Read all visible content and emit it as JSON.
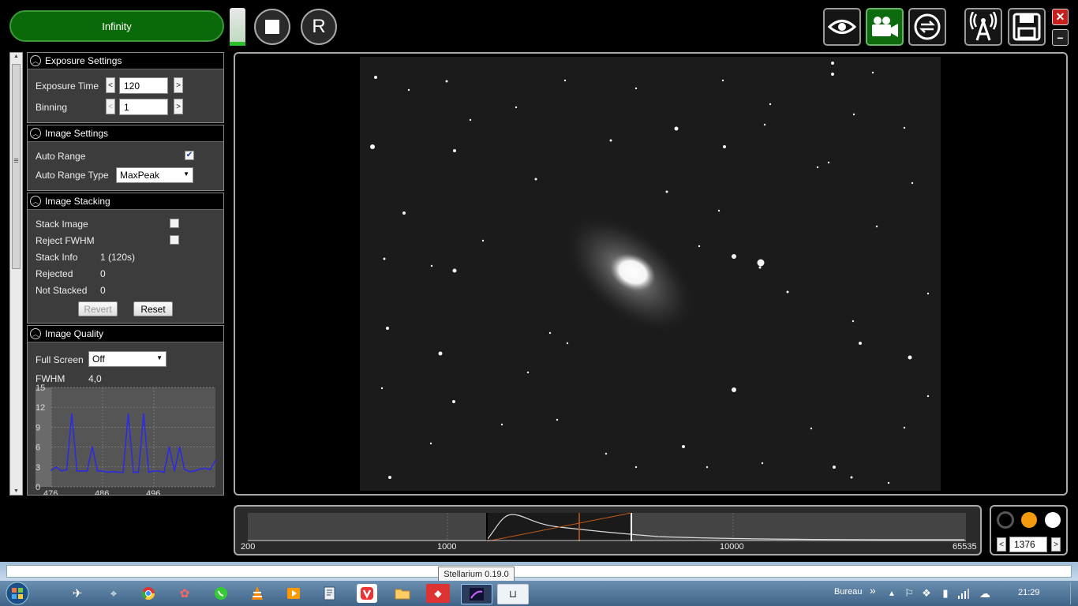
{
  "top_bar": {
    "mode_label": "Infinity",
    "stop_label": "■",
    "r_label": "R",
    "level_fraction": 0.1
  },
  "exposure": {
    "header": "Exposure Settings",
    "exposure_time_label": "Exposure Time",
    "exposure_time_value": "120",
    "binning_label": "Binning",
    "binning_value": "1",
    "dec": "<",
    "inc": ">"
  },
  "image_settings": {
    "header": "Image Settings",
    "auto_range_label": "Auto Range",
    "auto_range_checked": true,
    "auto_range_type_label": "Auto Range Type",
    "auto_range_type_value": "MaxPeak"
  },
  "stacking": {
    "header": "Image Stacking",
    "stack_image_label": "Stack Image",
    "reject_fwhm_label": "Reject FWHM",
    "stack_info_label": "Stack Info",
    "stack_info_value": "1 (120s)",
    "rejected_label": "Rejected",
    "rejected_value": "0",
    "not_stacked_label": "Not Stacked",
    "not_stacked_value": "0",
    "revert_label": "Revert",
    "reset_label": "Reset"
  },
  "quality": {
    "header": "Image Quality",
    "full_screen_label": "Full Screen",
    "full_screen_value": "Off",
    "fwhm_label": "FWHM",
    "fwhm_value": "4,0",
    "y_ticks": [
      "15",
      "12",
      "9",
      "6",
      "3",
      "0"
    ],
    "x_ticks": [
      "476",
      "486",
      "496"
    ]
  },
  "chart_data": {
    "type": "line",
    "ylim": [
      0,
      15
    ],
    "x": [
      476,
      477,
      478,
      479,
      480,
      481,
      482,
      483,
      484,
      485,
      486,
      487,
      488,
      489,
      490,
      491,
      492,
      493,
      494,
      495,
      496,
      497,
      498,
      499,
      500,
      501,
      502,
      503,
      504,
      505,
      506,
      507,
      508
    ],
    "series": [
      {
        "values": [
          2.5,
          3,
          2.4,
          2.6,
          11,
          2.4,
          2.4,
          2.4,
          6,
          2.4,
          2.4,
          2.2,
          2.3,
          2.2,
          2.2,
          11,
          2.2,
          2.2,
          11,
          2.2,
          2.4,
          2.4,
          2.2,
          6,
          2.4,
          6,
          2.6,
          2.3,
          2.4,
          2.7,
          2.8,
          2.6,
          4
        ]
      }
    ]
  },
  "histogram": {
    "labels": [
      "200",
      "1000",
      "10000",
      "65535"
    ],
    "level_value": "1376",
    "dec": "<",
    "inc": ">"
  },
  "taskbar": {
    "tooltip": "Stellarium 0.19.0",
    "bureau": "Bureau",
    "chevrons": "»",
    "time": "21:29"
  },
  "colors": {
    "mode_button": "#0a6a0a",
    "active_tool": "#0d6a0d",
    "close": "#c71e1e",
    "fwhm_line": "#2a2ae8",
    "level_orange": "#f39a0e"
  }
}
